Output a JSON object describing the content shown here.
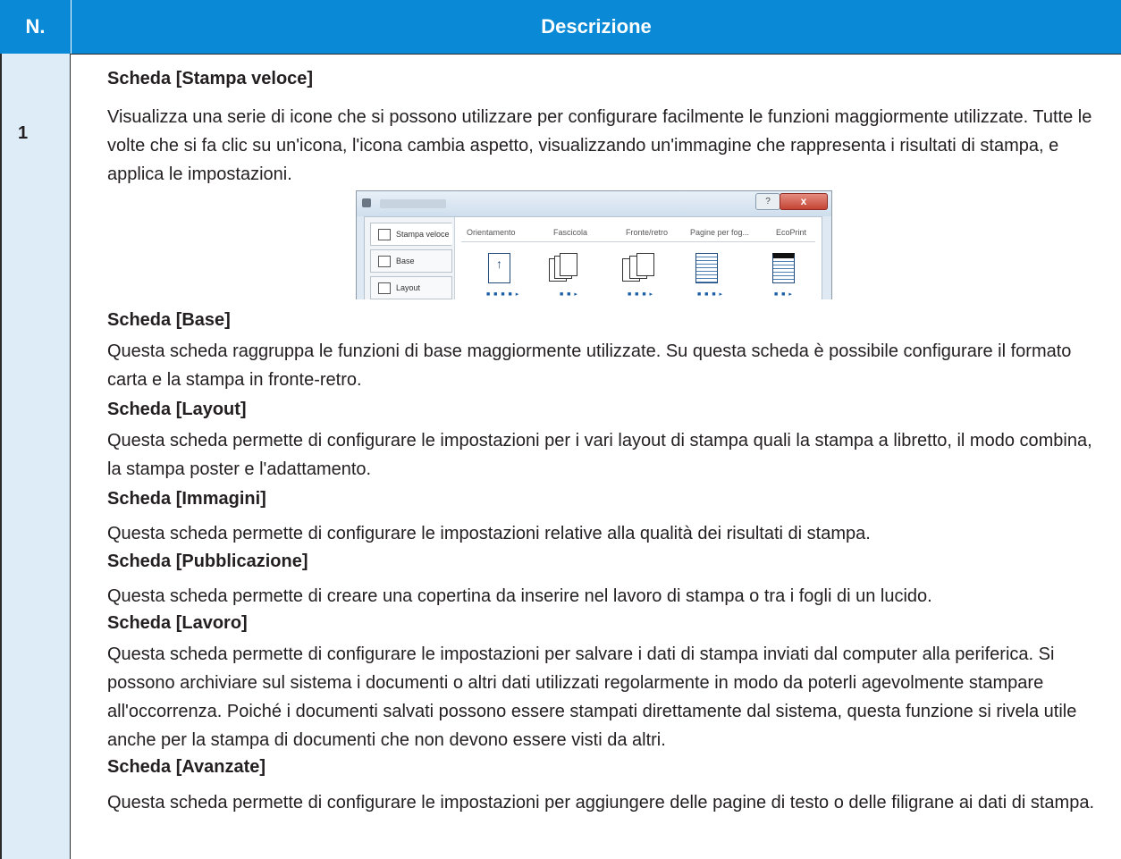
{
  "table": {
    "col_n": "N.",
    "col_desc": "Descrizione",
    "row_num": "1"
  },
  "sections": [
    {
      "title": "Scheda [Stampa veloce]",
      "text": "Visualizza una serie di icone che si possono utilizzare per configurare facilmente le funzioni maggiormente utilizzate. Tutte le volte che si fa clic su un'icona, l'icona cambia aspetto, visualizzando un'immagine che rappresenta i risultati di stampa, e applica le impostazioni."
    },
    {
      "title": "Scheda [Base]",
      "text": "Questa scheda raggruppa le funzioni di base maggiormente utilizzate. Su questa scheda è possibile configurare il formato carta e la stampa in fronte-retro."
    },
    {
      "title": "Scheda [Layout]",
      "text": "Questa scheda permette di configurare le impostazioni per i vari layout di stampa quali la stampa a libretto, il modo combina, la stampa poster e l'adattamento."
    },
    {
      "title": "Scheda [Immagini]",
      "text": "Questa scheda permette di configurare le impostazioni relative alla qualità dei risultati di stampa."
    },
    {
      "title": "Scheda [Pubblicazione]",
      "text": "Questa scheda permette di creare una copertina da inserire nel lavoro di stampa o tra i fogli di un lucido."
    },
    {
      "title": "Scheda [Lavoro]",
      "text": "Questa scheda permette di configurare le impostazioni per salvare i dati di stampa inviati dal computer alla periferica. Si possono archiviare sul sistema i documenti o altri dati utilizzati regolarmente in modo da poterli agevolmente stampare all'occorrenza. Poiché i documenti salvati possono essere stampati direttamente dal sistema, questa funzione si rivela utile anche per la stampa di documenti che non devono essere visti da altri."
    },
    {
      "title": "Scheda [Avanzate]",
      "text": "Questa scheda permette di configurare le impostazioni per aggiungere delle pagine di testo o delle filigrane ai dati di stampa."
    }
  ],
  "screenshot": {
    "help_button": "?",
    "close_button": "x",
    "tabs": [
      "Stampa veloce",
      "Base",
      "Layout"
    ],
    "columns": [
      "Orientamento",
      "Fascicola",
      "Fronte/retro",
      "Pagine per fog...",
      "EcoPrint"
    ],
    "page_arrow": "↑",
    "dot_patterns": [
      "■ ■ ■ ■ ▸",
      "■ ■ ▸",
      "■ ■ ■ ▸",
      "■ ■ ■ ▸",
      "■ ■ ▸"
    ]
  }
}
